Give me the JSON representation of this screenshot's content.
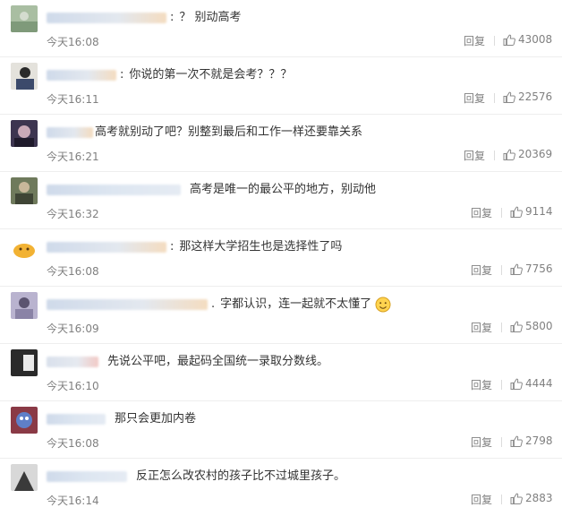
{
  "comments": [
    {
      "text": "？ 别动高考",
      "time": "今天16:08",
      "reply": "回复",
      "likes": "43008"
    },
    {
      "text": "你说的第一次不就是会考？？？",
      "time": "今天16:11",
      "reply": "回复",
      "likes": "22576"
    },
    {
      "text": "高考就别动了吧？别整到最后和工作一样还要靠关系",
      "time": "今天16:21",
      "reply": "回复",
      "likes": "20369"
    },
    {
      "text": "高考是唯一的最公平的地方，别动他",
      "time": "今天16:32",
      "reply": "回复",
      "likes": "9114"
    },
    {
      "text": "那这样大学招生也是选择性了吗",
      "time": "今天16:08",
      "reply": "回复",
      "likes": "7756"
    },
    {
      "text": "字都认识，连一起就不太懂了",
      "time": "今天16:09",
      "reply": "回复",
      "likes": "5800"
    },
    {
      "text": "先说公平吧，最起码全国统一录取分数线。",
      "time": "今天16:10",
      "reply": "回复",
      "likes": "4444"
    },
    {
      "text": "那只会更加内卷",
      "time": "今天16:08",
      "reply": "回复",
      "likes": "2798"
    },
    {
      "text": "反正怎么改农村的孩子比不过城里孩子。",
      "time": "今天16:14",
      "reply": "回复",
      "likes": "2883"
    }
  ],
  "icons": {
    "like": "thumbs-up-icon",
    "emoji": "smile-emoji-icon"
  },
  "colors": {
    "text": "#333333",
    "meta": "#808080",
    "blur": "#dbe3ee"
  }
}
